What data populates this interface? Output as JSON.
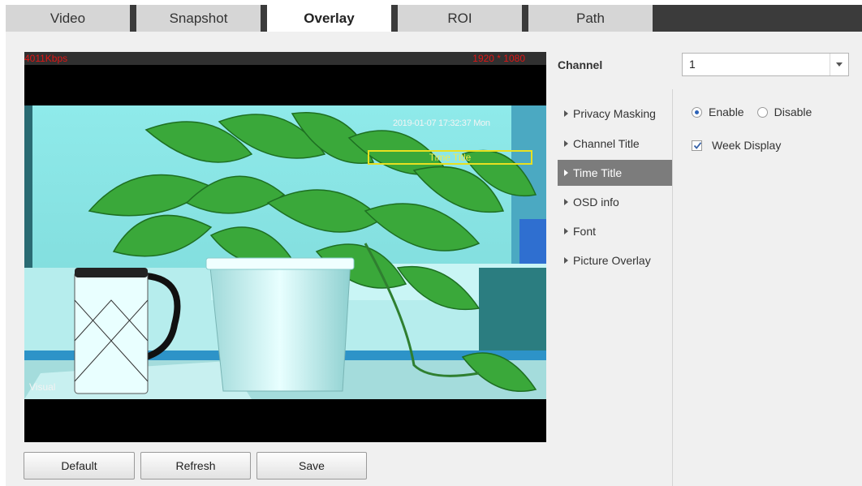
{
  "tabs": [
    {
      "label": "Video"
    },
    {
      "label": "Snapshot"
    },
    {
      "label": "Overlay"
    },
    {
      "label": "ROI"
    },
    {
      "label": "Path"
    }
  ],
  "video": {
    "bitrate": "4011Kbps",
    "resolution": "1920 * 1080",
    "timestamp": "2019-01-07 17:32:37 Mon",
    "time_title_box": "Time Title",
    "visual_label": "Visual"
  },
  "buttons": {
    "default": "Default",
    "refresh": "Refresh",
    "save": "Save"
  },
  "channel": {
    "label": "Channel",
    "value": "1"
  },
  "menu": [
    {
      "label": "Privacy Masking"
    },
    {
      "label": "Channel Title"
    },
    {
      "label": "Time Title",
      "active": true
    },
    {
      "label": "OSD info"
    },
    {
      "label": "Font"
    },
    {
      "label": "Picture Overlay"
    }
  ],
  "settings": {
    "enable_label": "Enable",
    "disable_label": "Disable",
    "enabled": true,
    "week_display_label": "Week Display",
    "week_display_checked": true
  },
  "colors": {
    "active_menu_bg": "#7c7c7c",
    "tab_bar_bg": "#3b3b3b",
    "overlay_text_red": "#e01515",
    "time_title_box": "#e8e020"
  }
}
